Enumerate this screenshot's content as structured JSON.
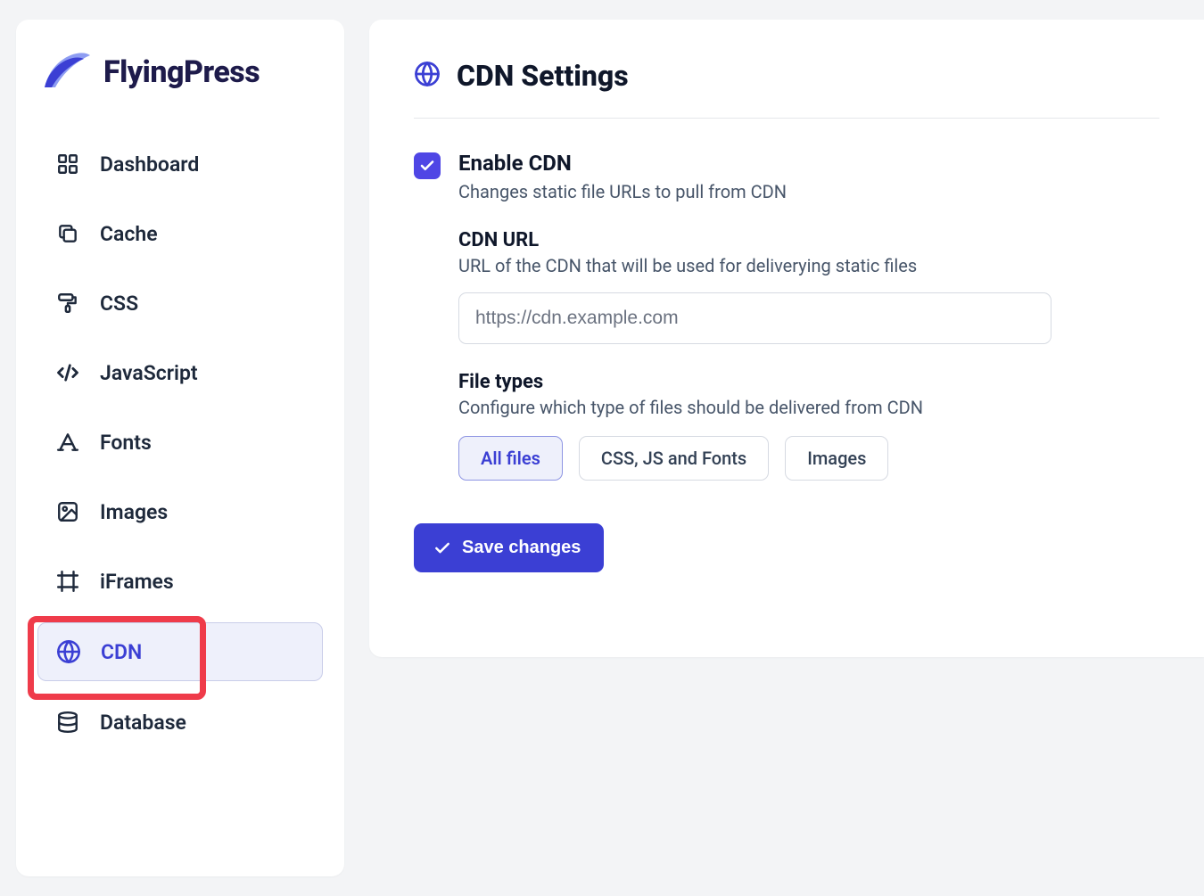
{
  "brand": {
    "name": "FlyingPress"
  },
  "sidebar": {
    "items": [
      {
        "id": "dashboard",
        "label": "Dashboard",
        "icon": "grid-icon"
      },
      {
        "id": "cache",
        "label": "Cache",
        "icon": "copy-icon"
      },
      {
        "id": "css",
        "label": "CSS",
        "icon": "paint-roller-icon"
      },
      {
        "id": "javascript",
        "label": "JavaScript",
        "icon": "code-icon"
      },
      {
        "id": "fonts",
        "label": "Fonts",
        "icon": "font-icon"
      },
      {
        "id": "images",
        "label": "Images",
        "icon": "image-icon"
      },
      {
        "id": "iframes",
        "label": "iFrames",
        "icon": "frame-icon"
      },
      {
        "id": "cdn",
        "label": "CDN",
        "icon": "globe-icon",
        "active": true,
        "highlighted": true
      },
      {
        "id": "database",
        "label": "Database",
        "icon": "database-icon"
      }
    ]
  },
  "page": {
    "title": "CDN Settings",
    "enable": {
      "checked": true,
      "title": "Enable CDN",
      "desc": "Changes static file URLs to pull from CDN"
    },
    "cdn_url": {
      "title": "CDN URL",
      "desc": "URL of the CDN that will be used for deliverying static files",
      "placeholder": "https://cdn.example.com",
      "value": ""
    },
    "file_types": {
      "title": "File types",
      "desc": "Configure which type of files should be delivered from CDN",
      "options": [
        {
          "label": "All files",
          "selected": true
        },
        {
          "label": "CSS, JS and Fonts",
          "selected": false
        },
        {
          "label": "Images",
          "selected": false
        }
      ]
    },
    "save_label": "Save changes"
  }
}
